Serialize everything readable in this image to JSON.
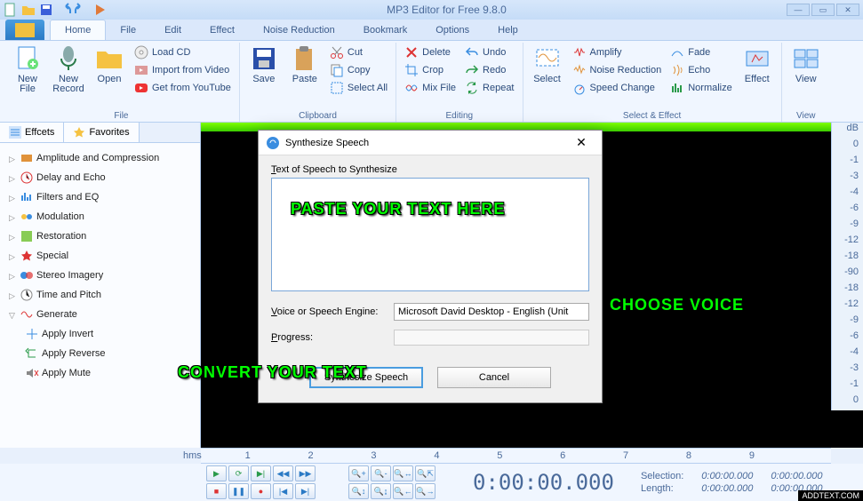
{
  "title": "MP3 Editor for Free 9.8.0",
  "menus": {
    "home": "Home",
    "file": "File",
    "edit": "Edit",
    "effect": "Effect",
    "noise": "Noise Reduction",
    "bookmark": "Bookmark",
    "options": "Options",
    "help": "Help"
  },
  "ribbon": {
    "file": {
      "label": "File",
      "newfile": "New\nFile",
      "newrecord": "New\nRecord",
      "open": "Open",
      "loadcd": "Load CD",
      "importvideo": "Import from Video",
      "youtube": "Get from YouTube"
    },
    "clipboard": {
      "label": "Clipboard",
      "save": "Save",
      "paste": "Paste",
      "cut": "Cut",
      "copy": "Copy",
      "selectall": "Select All"
    },
    "editing": {
      "label": "Editing",
      "delete": "Delete",
      "crop": "Crop",
      "mixfile": "Mix File",
      "undo": "Undo",
      "redo": "Redo",
      "repeat": "Repeat"
    },
    "select_effect": {
      "label": "Select & Effect",
      "select": "Select",
      "amplify": "Amplify",
      "noise": "Noise Reduction",
      "speed": "Speed Change",
      "fade": "Fade",
      "echo": "Echo",
      "normalize": "Normalize",
      "effect": "Effect"
    },
    "view": {
      "label": "View",
      "view": "View"
    }
  },
  "lefttabs": {
    "effects": "Effcets",
    "favorites": "Favorites"
  },
  "tree": [
    {
      "l": "Amplitude and Compression"
    },
    {
      "l": "Delay and Echo"
    },
    {
      "l": "Filters and EQ"
    },
    {
      "l": "Modulation"
    },
    {
      "l": "Restoration"
    },
    {
      "l": "Special"
    },
    {
      "l": "Stereo Imagery"
    },
    {
      "l": "Time and Pitch"
    },
    {
      "l": "Generate"
    }
  ],
  "treesubs": {
    "invert": "Apply Invert",
    "reverse": "Apply Reverse",
    "mute": "Apply Mute"
  },
  "dbscale": [
    "dB",
    "0",
    "-1",
    "-3",
    "-4",
    "-6",
    "-9",
    "-12",
    "-18",
    "-90",
    "-18",
    "-12",
    "-9",
    "-6",
    "-4",
    "-3",
    "-1",
    "0"
  ],
  "ruler": {
    "hms": "hms",
    "ticks": [
      "1",
      "2",
      "3",
      "4",
      "5",
      "6",
      "7",
      "8",
      "9"
    ]
  },
  "time": "0:00:00.000",
  "info": {
    "sel": "Selection:",
    "len": "Length:",
    "zero": "0:00:00.000"
  },
  "dialog": {
    "title": "Synthesize Speech",
    "textlabel_u": "T",
    "textlabel": "ext of Speech to Synthesize",
    "voice_u": "V",
    "voice": "oice or Speech Engine:",
    "voiceval": "Microsoft David Desktop - English (Unit",
    "prog_u": "P",
    "prog": "rogress:",
    "ok": "Synthesize Speech",
    "cancel": "Cancel"
  },
  "annot": {
    "paste": "PASTE YOUR TEXT HERE",
    "choose": "CHOOSE VOICE",
    "convert": "CONVERT YOUR TEXT"
  },
  "watermark": "ADDTEXT.COM"
}
